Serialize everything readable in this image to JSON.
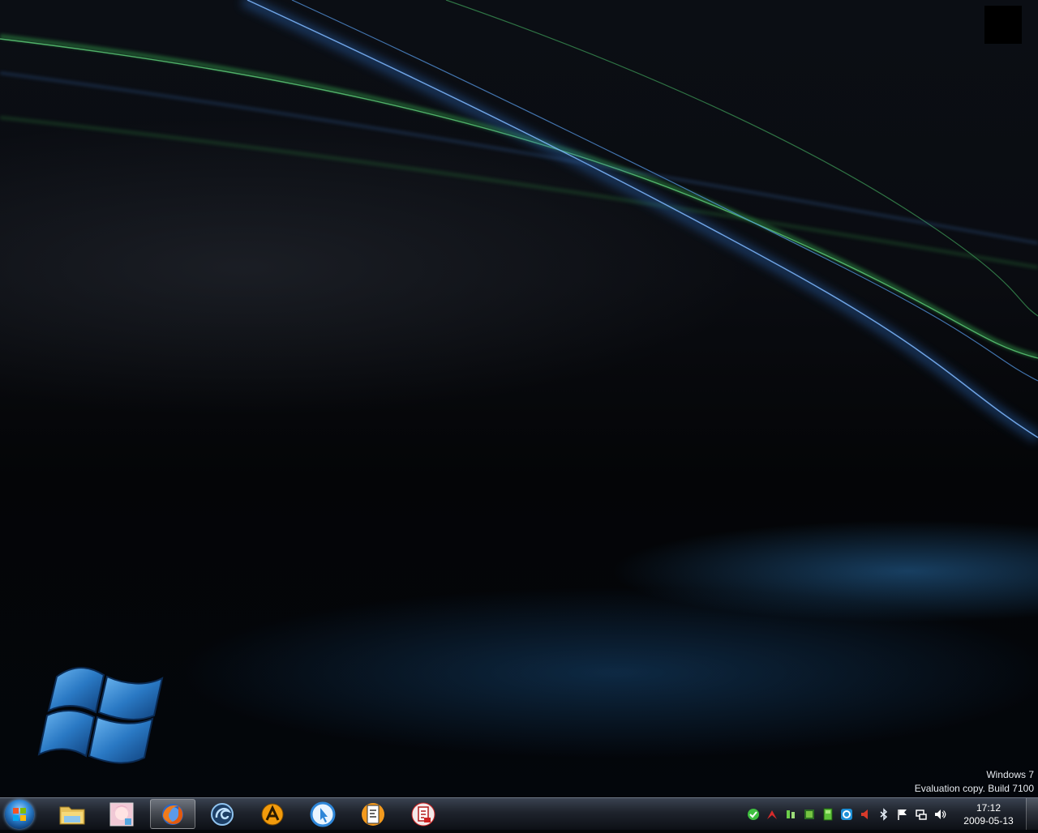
{
  "desktop": {
    "watermark": {
      "line1": "Windows 7",
      "line2": "Evaluation copy. Build 7100"
    }
  },
  "taskbar": {
    "start_button": {
      "icon": "windows-orb-icon"
    },
    "pinned": [
      {
        "name": "explorer",
        "icon": "folder-icon",
        "active": false
      },
      {
        "name": "anime-avatar-app",
        "icon": "avatar-picture-icon",
        "active": false
      },
      {
        "name": "firefox",
        "icon": "firefox-icon",
        "active": true
      },
      {
        "name": "blue-swirl-app",
        "icon": "blue-swirl-icon",
        "active": false
      },
      {
        "name": "orange-a-app",
        "icon": "orange-a-icon",
        "active": false
      },
      {
        "name": "blue-cursor-app",
        "icon": "blue-circle-cursor-icon",
        "active": false
      },
      {
        "name": "notepad-app",
        "icon": "notepad-face-icon",
        "active": false
      },
      {
        "name": "red-document-app",
        "icon": "red-document-icon",
        "active": false
      }
    ],
    "tray_icons": [
      "green-check-icon",
      "red-arrow-icon",
      "green-device-icon",
      "green-gpu-icon",
      "green-battery-icon",
      "network-globe-icon",
      "red-speaker-icon",
      "bluetooth-icon",
      "action-center-flag-icon",
      "network-icon",
      "volume-icon"
    ],
    "clock": {
      "time": "17:12",
      "date": "2009-05-13"
    }
  },
  "colors": {
    "taskbar_top": "#3a4250",
    "taskbar_bottom": "#0d1016",
    "accent_blue": "#2f86d6",
    "streak_green": "#3fbf5a",
    "streak_blue": "#3d7fd0"
  }
}
